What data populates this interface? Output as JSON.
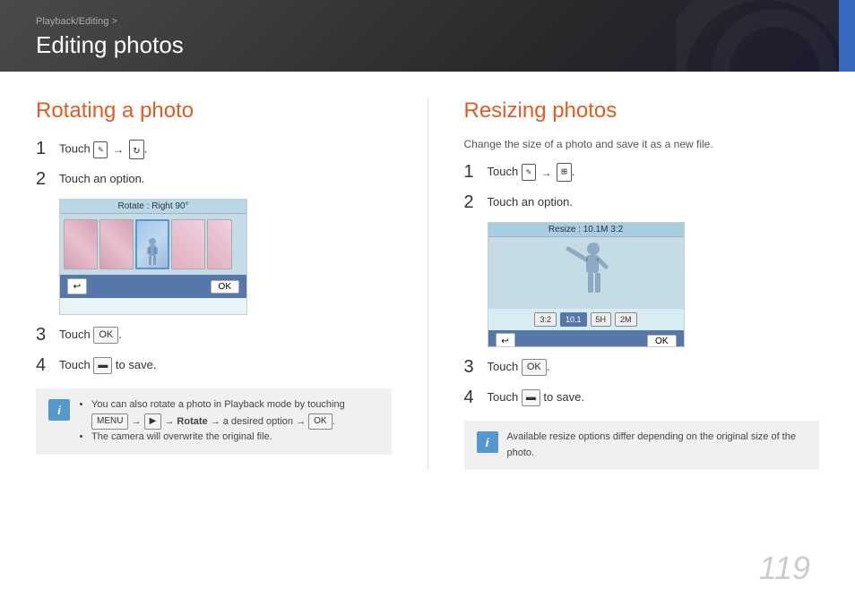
{
  "header": {
    "breadcrumb": "Playback/Editing >",
    "title": "Editing photos",
    "blue_tab": true
  },
  "left_section": {
    "title": "Rotating a photo",
    "steps": [
      {
        "num": "1",
        "text": "Touch",
        "icon1": "✎→",
        "icon2": "↻"
      },
      {
        "num": "2",
        "text": "Touch an option."
      },
      {
        "num": "3",
        "text": "Touch",
        "button": "OK"
      },
      {
        "num": "4",
        "text": "to save.",
        "button": "💾"
      }
    ],
    "screen": {
      "label": "Rotate : Right 90°",
      "thumbnails": [
        "pink1",
        "pink2",
        "selected",
        "pink3",
        "pink4"
      ]
    },
    "notes": [
      "You can also rotate a photo in Playback mode by touching  MENU  →  ▶  → Rotate → a desired option →  OK .",
      "The camera will overwrite the original file."
    ]
  },
  "right_section": {
    "title": "Resizing photos",
    "subtitle": "Change the size of a photo and save it as a new file.",
    "steps": [
      {
        "num": "1",
        "text": "Touch",
        "icon1": "✎→",
        "icon2": "▦"
      },
      {
        "num": "2",
        "text": "Touch an option."
      },
      {
        "num": "3",
        "text": "Touch",
        "button": "OK"
      },
      {
        "num": "4",
        "text": "to save.",
        "button": "💾"
      }
    ],
    "screen": {
      "label": "Resize : 10.1M 3:2",
      "options": [
        "3:2",
        "10.1",
        "5H",
        "2M"
      ]
    },
    "note": "Available resize options differ depending on the original size of the photo."
  },
  "page_number": "119"
}
